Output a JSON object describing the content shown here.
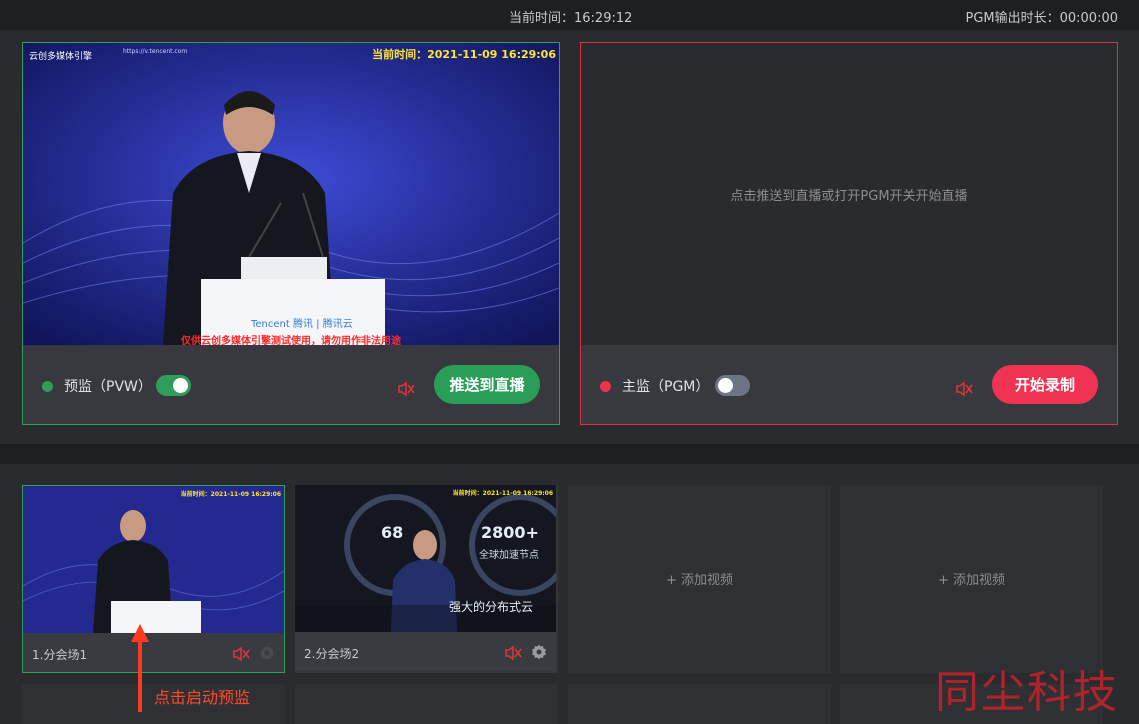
{
  "topbar": {
    "current_time": "当前时间：16:29:12",
    "pgm_duration": "PGM输出时长：00:00:00"
  },
  "pvw": {
    "label": "预监（PVW）",
    "toggle_on": true,
    "push_button": "推送到直播",
    "video": {
      "logo": "云创多媒体引擎",
      "url": "https://v.tencent.com",
      "timestamp": "当前时间：2021-11-09 16:29:06",
      "podium": "Tencent 腾讯 | 腾讯云",
      "warning": "仅供云创多媒体引擎测试使用，请勿用作非法用途"
    }
  },
  "pgm": {
    "label": "主监（PGM）",
    "toggle_on": false,
    "hint": "点击推送到直播或打开PGM开关开始直播",
    "record_button": "开始录制"
  },
  "sources": [
    {
      "title": "1.分会场1",
      "selected": true,
      "timestamp": "当前时间：2021-11-09 16:29:06"
    },
    {
      "title": "2.分会场2",
      "selected": false,
      "timestamp": "当前时间：2021-11-09 16:29:06",
      "screen_text_a": "68",
      "screen_text_b": "2800+",
      "screen_text_c": "全球加速节点",
      "screen_text_d": "强大的分布式云"
    }
  ],
  "add_video_label": "+ 添加视频",
  "annotation": "点击启动预监",
  "watermark": "同尘科技",
  "colors": {
    "pvw_accent": "#2f9e5a",
    "pgm_accent": "#f03353",
    "background": "#1e1f23"
  }
}
